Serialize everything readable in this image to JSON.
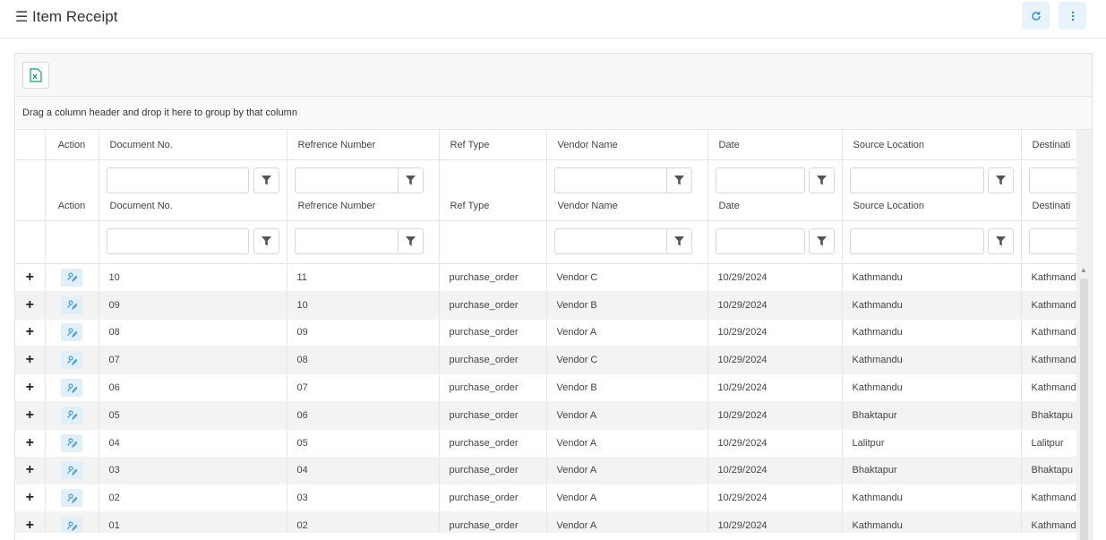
{
  "header": {
    "title": "Item Receipt"
  },
  "group_panel": {
    "text": "Drag a column header and drop it here to group by that column"
  },
  "columns": [
    {
      "label": "Action"
    },
    {
      "label": "Document No."
    },
    {
      "label": "Refrence Number"
    },
    {
      "label": "Ref Type"
    },
    {
      "label": "Vendor Name"
    },
    {
      "label": "Date"
    },
    {
      "label": "Source Location"
    },
    {
      "label": "Destinati"
    }
  ],
  "rows": [
    {
      "doc": "10",
      "ref": "11",
      "type": "purchase_order",
      "vendor": "Vendor C",
      "date": "10/29/2024",
      "source": "Kathmandu",
      "dest": "Kathmand"
    },
    {
      "doc": "09",
      "ref": "10",
      "type": "purchase_order",
      "vendor": "Vendor B",
      "date": "10/29/2024",
      "source": "Kathmandu",
      "dest": "Kathmand"
    },
    {
      "doc": "08",
      "ref": "09",
      "type": "purchase_order",
      "vendor": "Vendor A",
      "date": "10/29/2024",
      "source": "Kathmandu",
      "dest": "Kathmand"
    },
    {
      "doc": "07",
      "ref": "08",
      "type": "purchase_order",
      "vendor": "Vendor C",
      "date": "10/29/2024",
      "source": "Kathmandu",
      "dest": "Kathmand"
    },
    {
      "doc": "06",
      "ref": "07",
      "type": "purchase_order",
      "vendor": "Vendor B",
      "date": "10/29/2024",
      "source": "Kathmandu",
      "dest": "Kathmand"
    },
    {
      "doc": "05",
      "ref": "06",
      "type": "purchase_order",
      "vendor": "Vendor A",
      "date": "10/29/2024",
      "source": "Bhaktapur",
      "dest": "Bhaktapu"
    },
    {
      "doc": "04",
      "ref": "05",
      "type": "purchase_order",
      "vendor": "Vendor A",
      "date": "10/29/2024",
      "source": "Lalitpur",
      "dest": "Lalitpur"
    },
    {
      "doc": "03",
      "ref": "04",
      "type": "purchase_order",
      "vendor": "Vendor A",
      "date": "10/29/2024",
      "source": "Bhaktapur",
      "dest": "Bhaktapu"
    },
    {
      "doc": "02",
      "ref": "03",
      "type": "purchase_order",
      "vendor": "Vendor A",
      "date": "10/29/2024",
      "source": "Kathmandu",
      "dest": "Kathmand"
    },
    {
      "doc": "01",
      "ref": "02",
      "type": "purchase_order",
      "vendor": "Vendor A",
      "date": "10/29/2024",
      "source": "Kathmandu",
      "dest": "Kathmand"
    }
  ],
  "icons": {
    "menu": "menu-icon",
    "refresh": "refresh-icon",
    "more": "more-vertical-icon",
    "excel": "excel-export-icon",
    "filter": "filter-icon",
    "expand": "plus-icon",
    "edit": "user-edit-icon"
  },
  "colors": {
    "accent": "#2a8ad4",
    "accent_bg": "#e8f3fb",
    "excel": "#1d9e6a"
  }
}
